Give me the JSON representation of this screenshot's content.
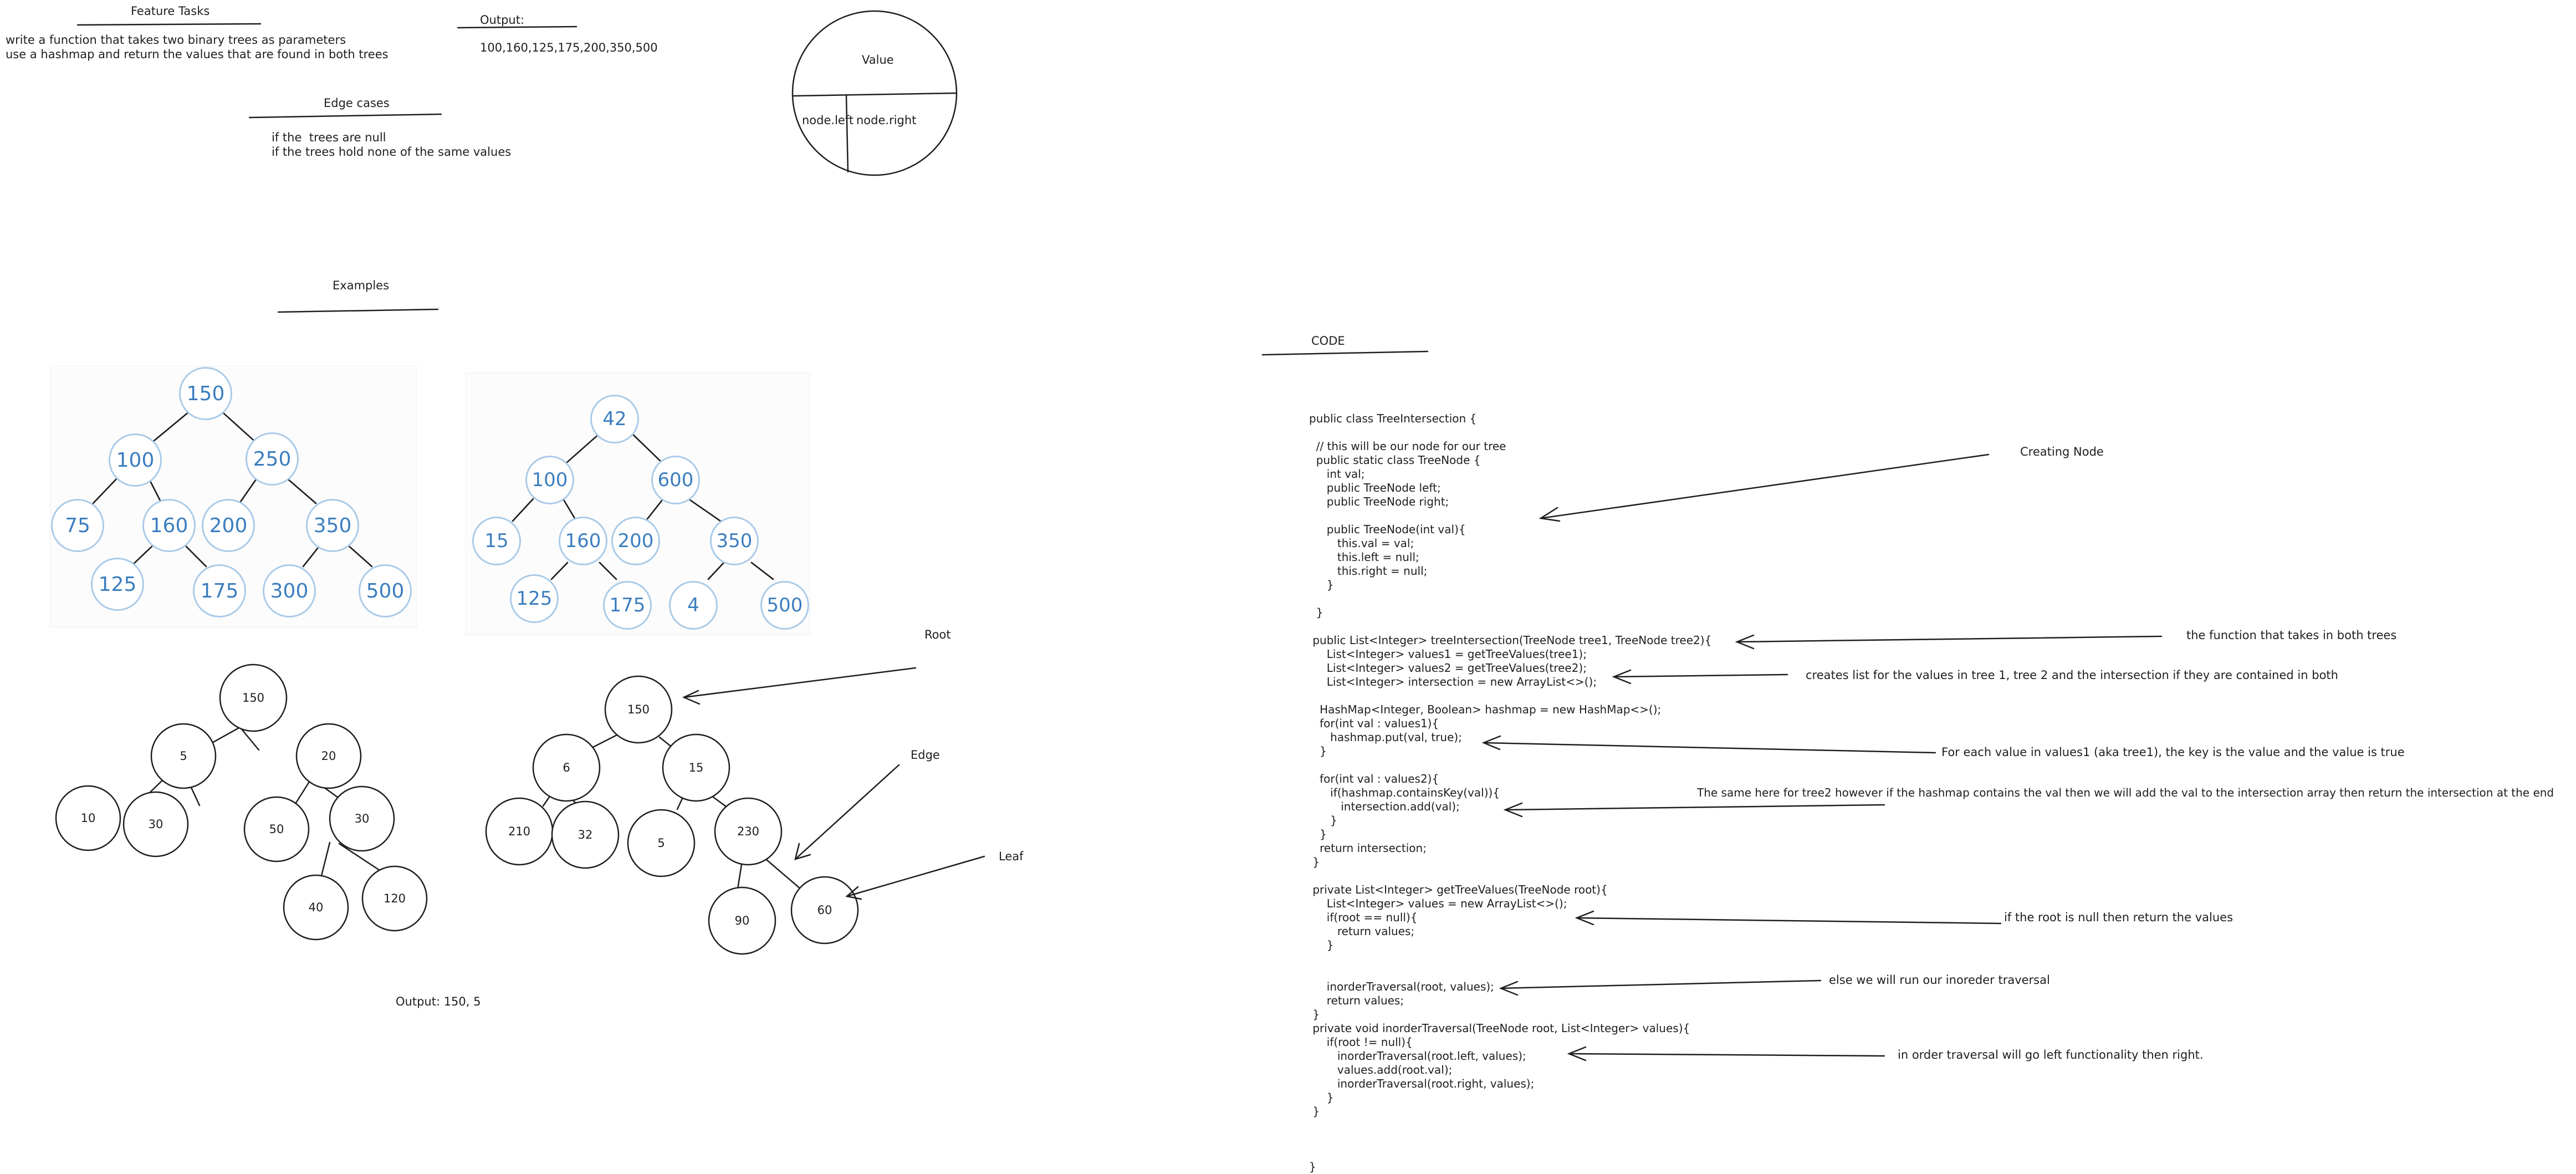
{
  "feature_tasks": {
    "title": "Feature Tasks",
    "description_lines": [
      "write a function that takes two binary trees as parameters",
      "use a hashmap and return the values that are found in both trees"
    ]
  },
  "output_section": {
    "title": "Output:",
    "value": "100,160,125,175,200,350,500"
  },
  "edge_cases": {
    "title": "Edge cases",
    "items": [
      "if the  trees are null",
      "if the trees hold none of the same values"
    ]
  },
  "node_legend": {
    "value": "Value",
    "left": "node.left",
    "right": "node.right"
  },
  "examples": {
    "title": "Examples",
    "tree1_nodes": [
      "150",
      "100",
      "250",
      "75",
      "160",
      "200",
      "350",
      "125",
      "175",
      "300",
      "500"
    ],
    "tree2_nodes": [
      "42",
      "100",
      "600",
      "15",
      "160",
      "200",
      "350",
      "125",
      "175",
      "4",
      "500"
    ]
  },
  "hand_trees": {
    "tree_a": [
      "150",
      "5",
      "20",
      "10",
      "30",
      "50",
      "30",
      "40",
      "120"
    ],
    "tree_b": [
      "150",
      "6",
      "15",
      "210",
      "32",
      "5",
      "230",
      "90",
      "60"
    ],
    "output_text": "Output: 150, 5",
    "root_label": "Root",
    "edge_label": "Edge",
    "leaf_label": "Leaf"
  },
  "code_section": {
    "title": "CODE",
    "lines": [
      "public class TreeIntersection {",
      "",
      "  // this will be our node for our tree",
      "  public static class TreeNode {",
      "     int val;",
      "     public TreeNode left;",
      "     public TreeNode right;",
      "",
      "     public TreeNode(int val){",
      "        this.val = val;",
      "        this.left = null;",
      "        this.right = null;",
      "     }",
      "",
      "  }",
      "",
      " public List<Integer> treeIntersection(TreeNode tree1, TreeNode tree2){",
      "     List<Integer> values1 = getTreeValues(tree1);",
      "     List<Integer> values2 = getTreeValues(tree2);",
      "     List<Integer> intersection = new ArrayList<>();",
      "",
      "   HashMap<Integer, Boolean> hashmap = new HashMap<>();",
      "   for(int val : values1){",
      "      hashmap.put(val, true);",
      "   }",
      "",
      "   for(int val : values2){",
      "      if(hashmap.containsKey(val)){",
      "         intersection.add(val);",
      "      }",
      "   }",
      "   return intersection;",
      " }",
      "",
      " private List<Integer> getTreeValues(TreeNode root){",
      "     List<Integer> values = new ArrayList<>();",
      "     if(root == null){",
      "        return values;",
      "     }",
      "",
      "",
      "     inorderTraversal(root, values);",
      "     return values;",
      " }",
      " private void inorderTraversal(TreeNode root, List<Integer> values){",
      "     if(root != null){",
      "        inorderTraversal(root.left, values);",
      "        values.add(root.val);",
      "        inorderTraversal(root.right, values);",
      "     }",
      " }",
      "",
      "",
      "",
      "}"
    ]
  },
  "annotations": {
    "creating_node": "Creating Node",
    "function_both_trees": "the function that takes in both trees",
    "creates_list": "creates list for the values in tree 1, tree 2 and the intersection if they are contained in both",
    "for_each": "For each value in values1 (aka tree1), the key is the value and the value is true",
    "same_here": "The same here for tree2 however if the hashmap contains the val then we will add the val to the intersection array then return the intersection at the end",
    "root_null": "if the root is null then return the values",
    "else_run": "else we will run our inoreder traversal",
    "in_order": "in order traversal will go left functionality then right."
  },
  "colors": {
    "ink": "#1e1e1e",
    "node_text_blue": "#3b7dbf",
    "node_border_blue": "#aacbe8"
  }
}
